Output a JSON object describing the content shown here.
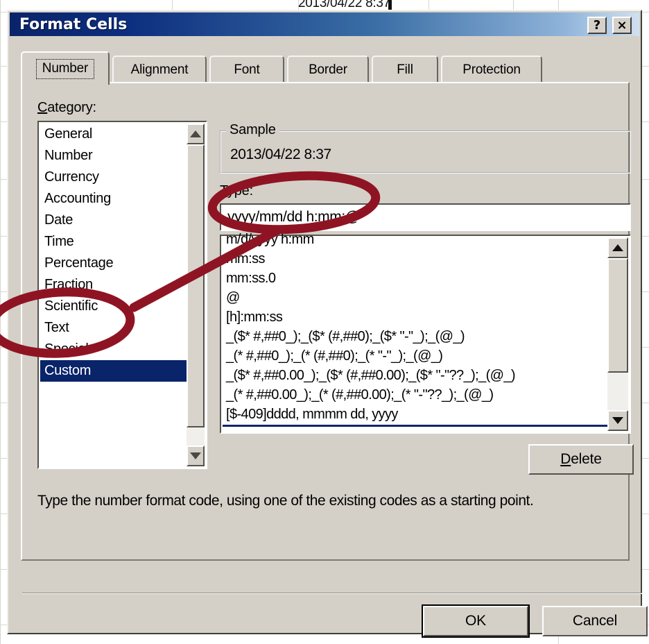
{
  "background_sheet": {
    "cell_text": "2013/04/22 8:37"
  },
  "dialog": {
    "title": "Format Cells",
    "help_button": "?",
    "close_button": "×",
    "tabs": [
      {
        "label": "Number",
        "active": true
      },
      {
        "label": "Alignment",
        "active": false
      },
      {
        "label": "Font",
        "active": false
      },
      {
        "label": "Border",
        "active": false
      },
      {
        "label": "Fill",
        "active": false
      },
      {
        "label": "Protection",
        "active": false
      }
    ],
    "category": {
      "label": "Category:",
      "items": [
        "General",
        "Number",
        "Currency",
        "Accounting",
        "Date",
        "Time",
        "Percentage",
        "Fraction",
        "Scientific",
        "Text",
        "Special",
        "Custom"
      ],
      "selected": "Custom"
    },
    "sample": {
      "legend": "Sample",
      "value": "2013/04/22 8:37"
    },
    "type": {
      "label": "Type:",
      "value": "yyyy/mm/dd h:mm;@",
      "items": [
        "m/d/yyyy h:mm",
        "mm:ss",
        "mm:ss.0",
        "@",
        "[h]:mm:ss",
        "_($* #,##0_);_($* (#,##0);_($* \"-\"_);_(@_)",
        "_(* #,##0_);_(* (#,##0);_(* \"-\"_);_(@_)",
        "_($* #,##0.00_);_($* (#,##0.00);_($* \"-\"??_);_(@_)",
        "_(* #,##0.00_);_(* (#,##0.00);_(* \"-\"??_);_(@_)",
        "[$-409]dddd, mmmm dd, yyyy",
        "yyyy/mm/dd h:mm;@"
      ],
      "selected": "yyyy/mm/dd h:mm;@"
    },
    "delete_button": "Delete",
    "description": "Type the number format code, using one of the existing codes as a starting point.",
    "ok_button": "OK",
    "cancel_button": "Cancel"
  },
  "annotation": {
    "color": "#8f1423",
    "shapes": "ellipse-around-custom, ellipse-around-type-input, arrow-connecting"
  },
  "colors": {
    "dialog_face": "#d4d0c8",
    "title_start": "#0a246a",
    "title_end": "#cfe0f0",
    "selection": "#0a246a",
    "annotation_red": "#8f1423"
  }
}
